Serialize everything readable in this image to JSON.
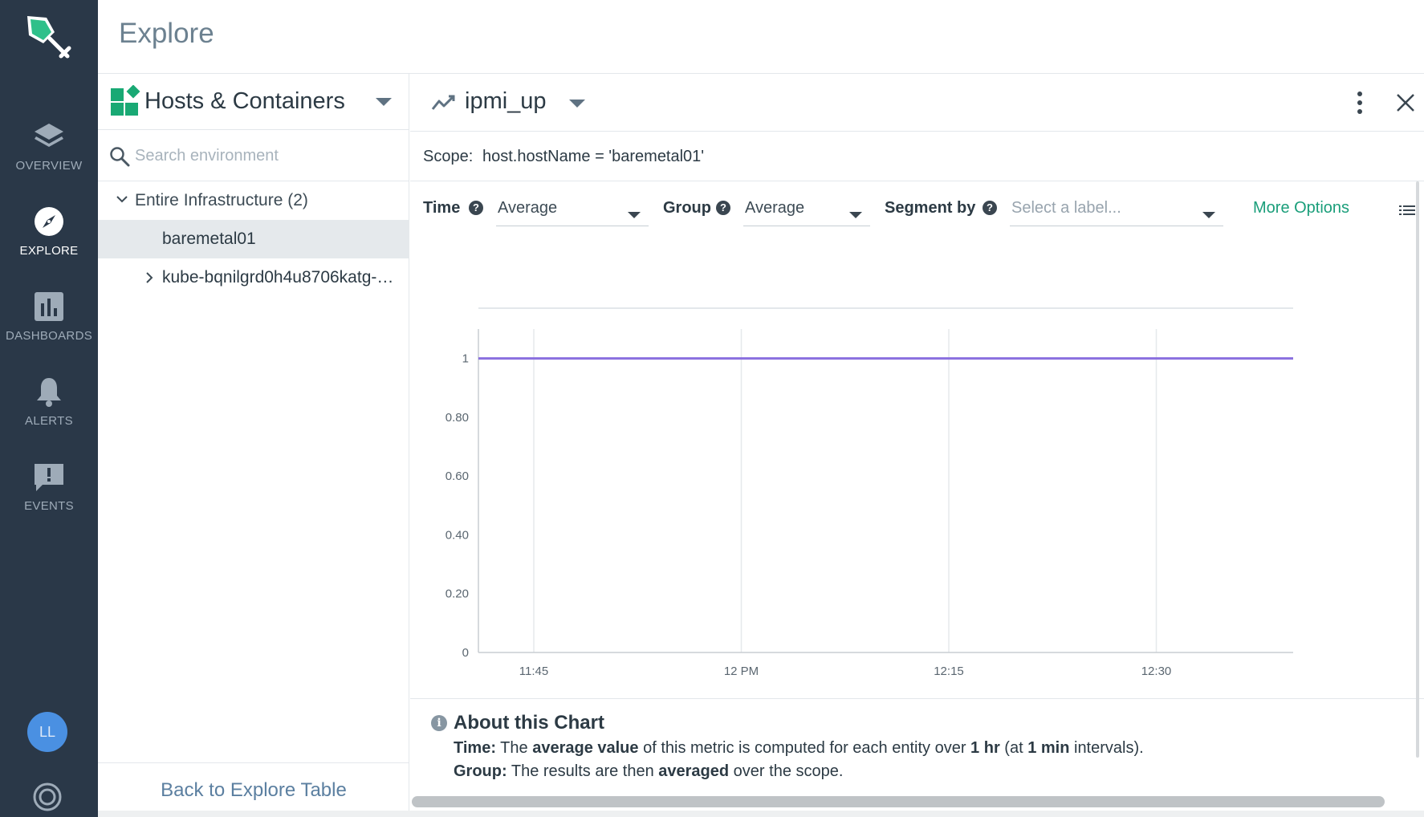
{
  "app": {
    "page_title": "Explore"
  },
  "nav": {
    "items": [
      {
        "label": "OVERVIEW",
        "icon": "layers-icon"
      },
      {
        "label": "EXPLORE",
        "icon": "compass-icon",
        "active": true
      },
      {
        "label": "DASHBOARDS",
        "icon": "bar-chart-icon"
      },
      {
        "label": "ALERTS",
        "icon": "bell-icon"
      },
      {
        "label": "EVENTS",
        "icon": "message-alert-icon"
      }
    ],
    "avatar_initials": "LL"
  },
  "left_panel": {
    "title": "Hosts & Containers",
    "search_placeholder": "Search environment",
    "tree_root": "Entire Infrastructure (2)",
    "tree_items": [
      {
        "label": "baremetal01",
        "selected": true
      },
      {
        "label": "kube-bqnilgrd0h4u8706katg-m...",
        "selected": false
      }
    ],
    "back_link": "Back to Explore Table"
  },
  "metric": {
    "name": "ipmi_up",
    "scope_label": "Scope:",
    "scope_value": "host.hostName = 'baremetal01'"
  },
  "controls": {
    "time_label": "Time",
    "time_value": "Average",
    "group_label": "Group",
    "group_value": "Average",
    "segment_label": "Segment by",
    "segment_placeholder": "Select a label...",
    "more_options": "More Options",
    "help_glyph": "?"
  },
  "chart_data": {
    "type": "line",
    "x_ticks": [
      "11:45",
      "12 PM",
      "12:15",
      "12:30"
    ],
    "y_ticks": [
      "0",
      "0.20",
      "0.40",
      "0.60",
      "0.80",
      "1"
    ],
    "ylim": [
      0,
      1.1
    ],
    "series": [
      {
        "color": "#8a6fdf",
        "values": [
          1,
          1,
          1,
          1,
          1
        ]
      }
    ],
    "grid_vertical": true
  },
  "about": {
    "info_glyph": "i",
    "title": "About this Chart",
    "time_prefix": "Time:",
    "time_t1": " The ",
    "time_b1": "average value",
    "time_t2": " of this metric is computed for each entity over ",
    "time_b2": "1 hr",
    "time_t3": " (at ",
    "time_b3": "1 min",
    "time_t4": " intervals).",
    "group_prefix": "Group:",
    "group_t1": " The results are then ",
    "group_b1": "averaged",
    "group_t2": " over the scope."
  },
  "colors": {
    "sidebar_bg": "#2a3848",
    "accent_green": "#1a9e7a",
    "line_purple": "#8a6fdf",
    "avatar_blue": "#4a90e2"
  }
}
